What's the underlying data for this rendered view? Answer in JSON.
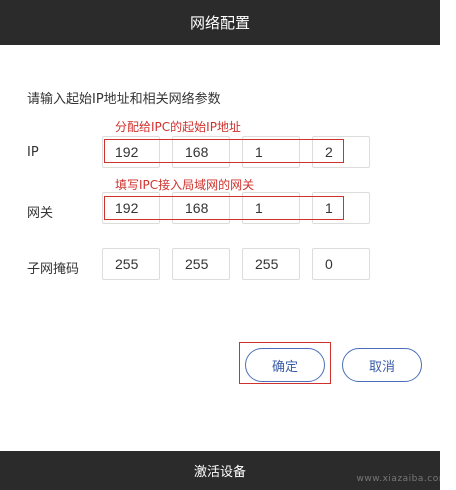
{
  "header": {
    "title": "网络配置"
  },
  "instruction": "请输入起始IP地址和相关网络参数",
  "annotations": {
    "ip_note": "分配给IPC的起始IP地址",
    "gateway_note": "填写IPC接入局域网的网关"
  },
  "rows": {
    "ip": {
      "label": "IP",
      "octets": [
        "192",
        "168",
        "1",
        "2"
      ]
    },
    "gateway": {
      "label": "网关",
      "octets": [
        "192",
        "168",
        "1",
        "1"
      ]
    },
    "mask": {
      "label": "子网掩码",
      "octets": [
        "255",
        "255",
        "255",
        "0"
      ]
    }
  },
  "buttons": {
    "confirm": "确定",
    "cancel": "取消"
  },
  "footer": {
    "label": "激活设备"
  },
  "watermark": "www.xiazaiba.com",
  "colors": {
    "header_bg": "#2b2b2b",
    "annotation_red": "#d0312d",
    "button_blue": "#3a5da8"
  }
}
